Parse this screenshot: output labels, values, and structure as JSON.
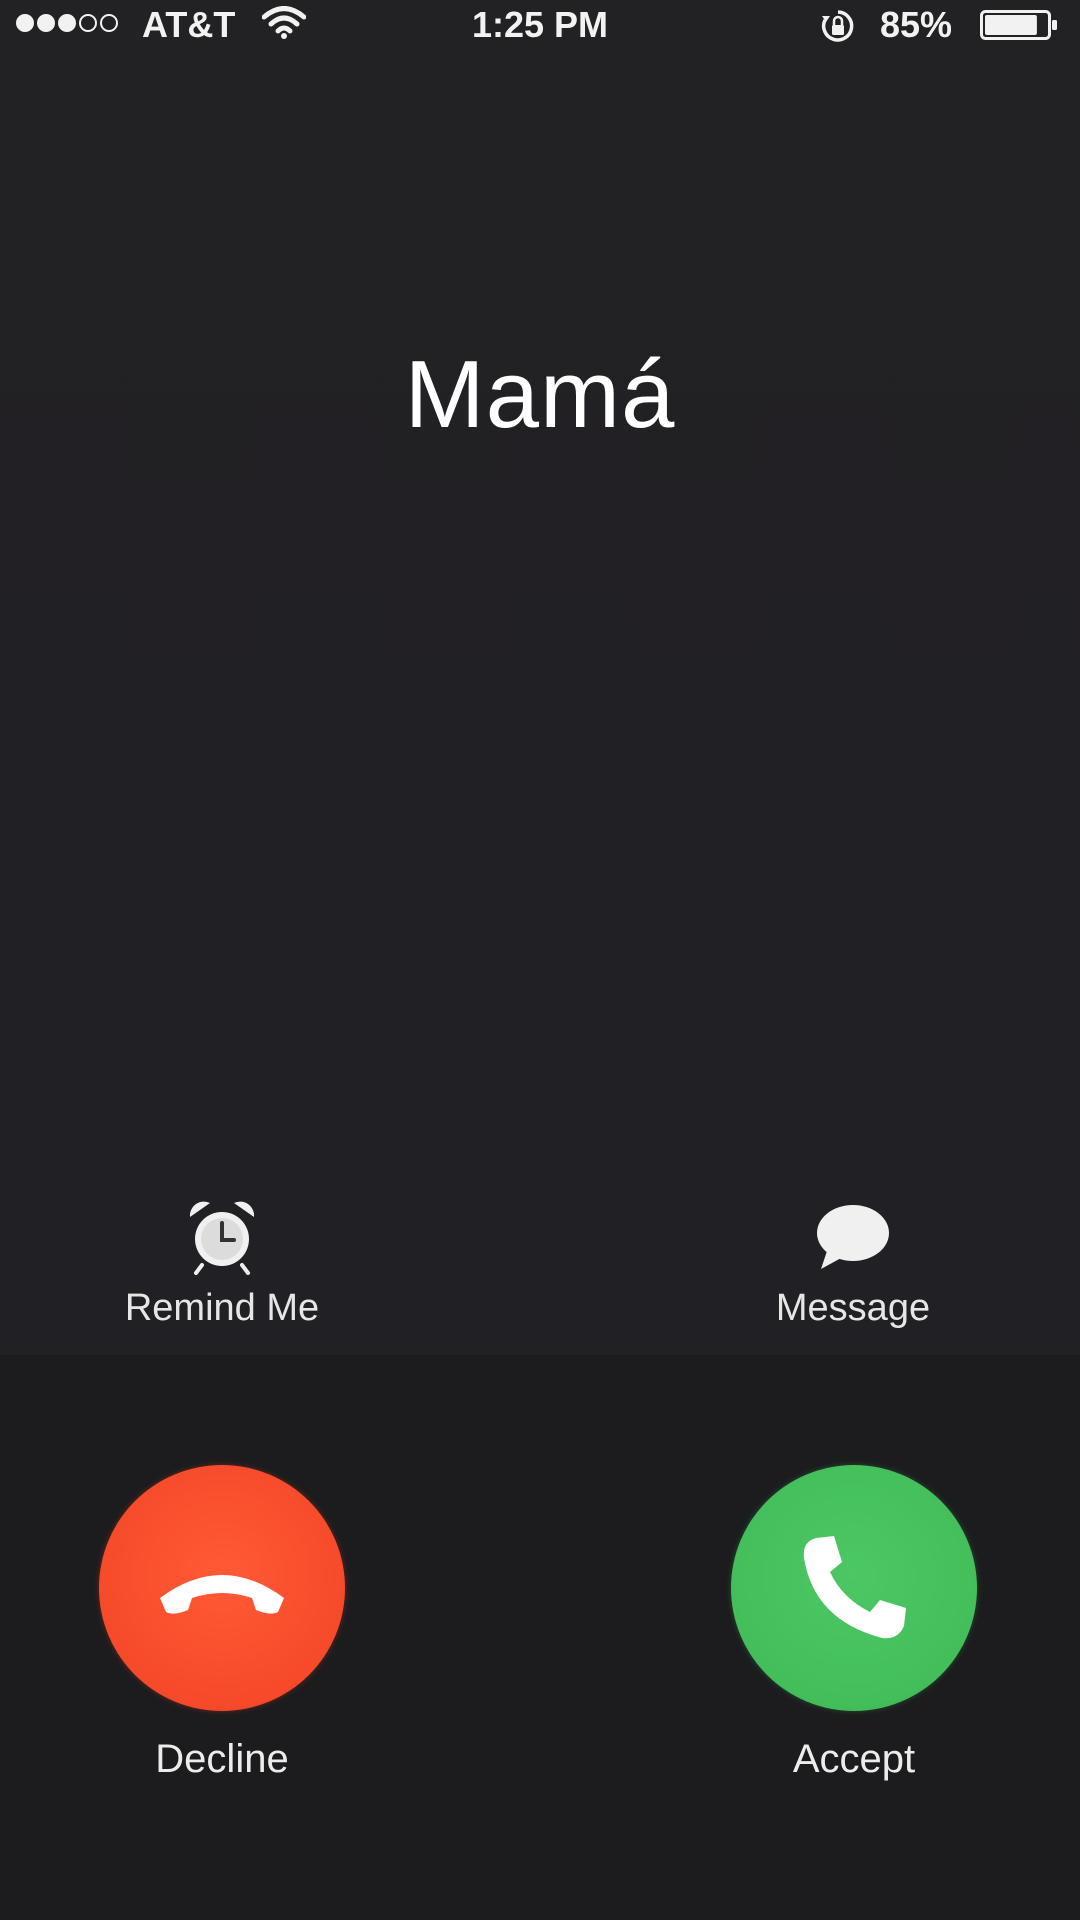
{
  "status_bar": {
    "signal_bars_filled": 3,
    "signal_bars_total": 5,
    "carrier": "AT&T",
    "time": "1:25 PM",
    "battery_percent": "85%",
    "battery_level": 0.85,
    "icons": [
      "wifi-icon",
      "orientation-lock-icon",
      "battery-icon"
    ]
  },
  "call": {
    "caller_name": "Mamá"
  },
  "secondary_actions": {
    "remind_label": "Remind Me",
    "remind_icon": "alarm-clock-icon",
    "message_label": "Message",
    "message_icon": "speech-bubble-icon"
  },
  "call_actions": {
    "decline_label": "Decline",
    "decline_icon": "phone-hangup-icon",
    "accept_label": "Accept",
    "accept_icon": "phone-icon"
  },
  "colors": {
    "background": "#212023",
    "decline": "#f64a2a",
    "accept": "#43be5a",
    "text": "#ffffff"
  }
}
